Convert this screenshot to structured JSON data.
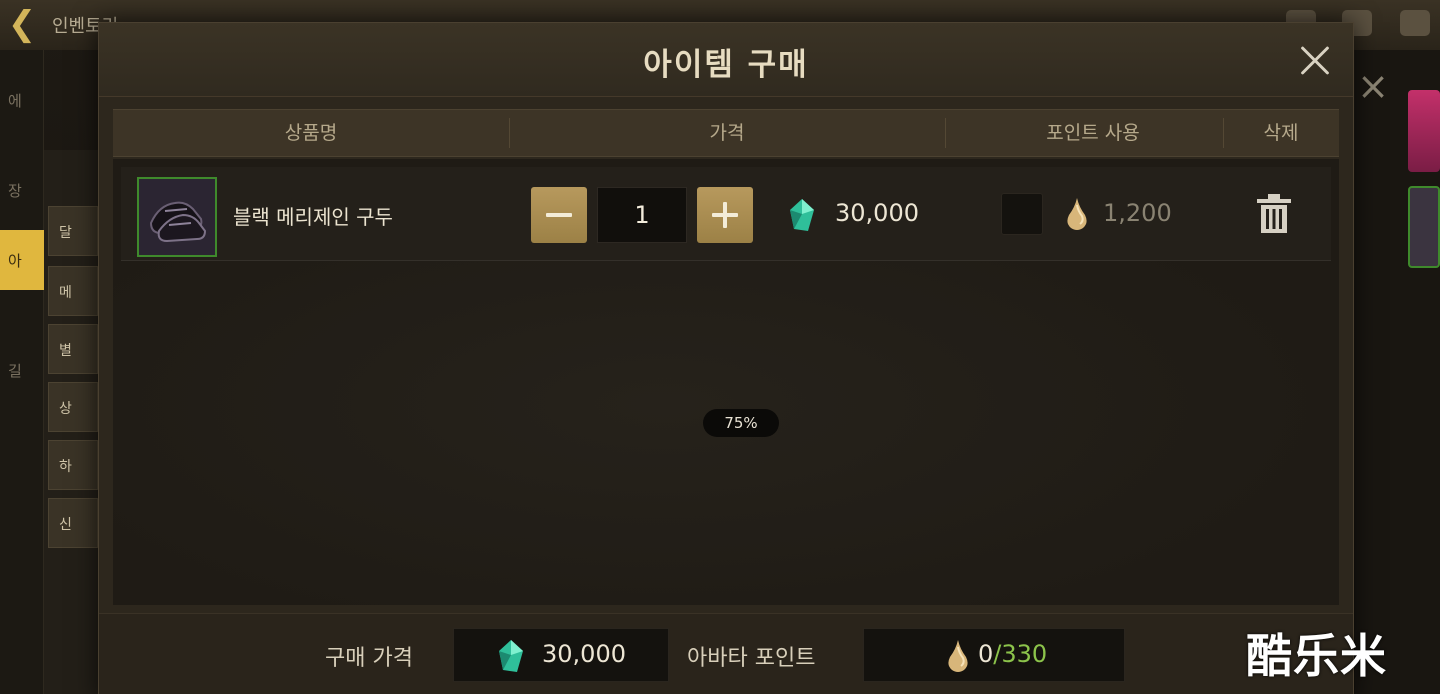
{
  "background": {
    "back_icon": "arrow-left-icon",
    "title": "인벤토리",
    "side_tabs": [
      "에",
      "장",
      "아",
      "길"
    ],
    "list_items": [
      "달",
      "메",
      "별",
      "상",
      "하",
      "신"
    ]
  },
  "modal": {
    "title": "아이템 구매",
    "close_icon": "close-icon",
    "columns": {
      "name": "상품명",
      "price": "가격",
      "use_points": "포인트 사용",
      "delete": "삭제"
    },
    "items": [
      {
        "icon": "shoes-icon",
        "name": "블랙 메리제인 구두",
        "quantity": "1",
        "price": "30,000",
        "price_icon": "gem-icon",
        "use_points_checked": false,
        "points": "1,200",
        "points_icon": "drop-icon",
        "delete_icon": "trash-icon"
      }
    ],
    "loading_percent": "75%",
    "footer": {
      "purchase_price_label": "구매 가격",
      "purchase_price": "30,000",
      "avatar_points_label": "아바타 포인트",
      "avatar_points_used": "0",
      "avatar_points_total": "/330"
    }
  },
  "watermark": "酷乐米",
  "colors": {
    "accent_gold": "#b7995d",
    "gem_teal": "#3cd0a8",
    "points_green": "#8cc34b",
    "item_border_green": "#3f8a2c"
  }
}
